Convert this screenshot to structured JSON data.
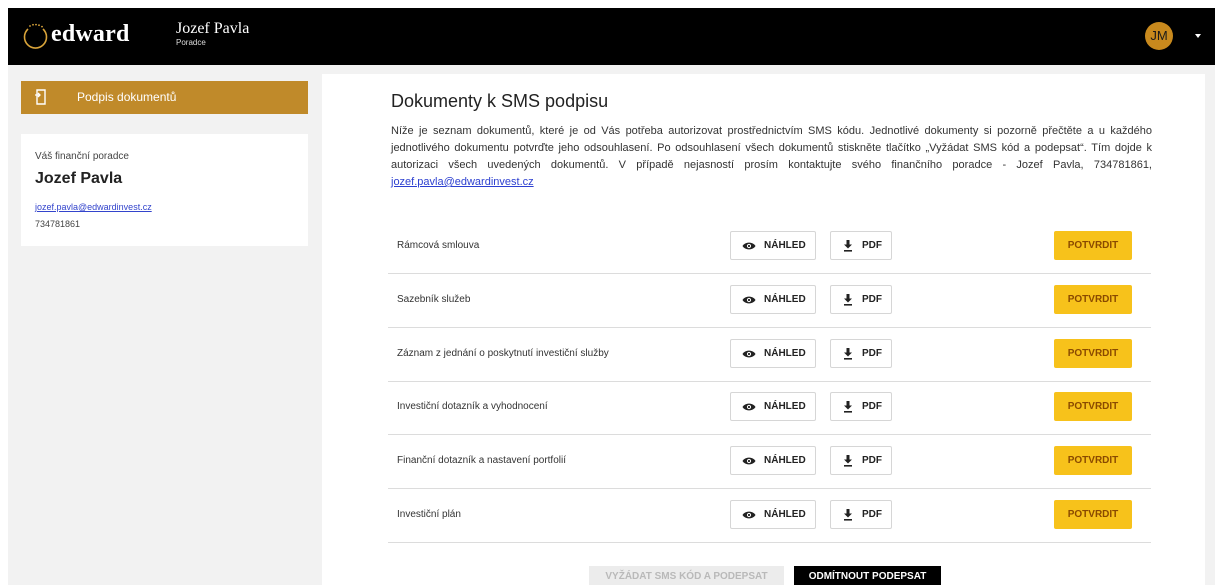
{
  "header": {
    "logo_text": "edward",
    "user_name": "Jozef Pavla",
    "user_role": "Poradce",
    "avatar_initials": "JM"
  },
  "sidebar": {
    "nav_item_label": "Podpis dokumentů",
    "advisor": {
      "label": "Váš finanční poradce",
      "name": "Jozef Pavla",
      "email": "jozef.pavla@edwardinvest.cz",
      "phone": "734781861"
    }
  },
  "main": {
    "title": "Dokumenty k SMS podpisu",
    "intro_text": "Níže je seznam dokumentů, které je od Vás potřeba autorizovat prostřednictvím SMS kódu. Jednotlivé dokumenty si pozorně přečtěte a u každého jednotlivého dokumentu potvrďte jeho odsouhlasení. Po odsouhlasení všech dokumentů stiskněte tlačítko „Vyžádat SMS kód a podepsat“. Tím dojde k autorizaci všech uvedených dokumentů. V případě nejasností prosím kontaktujte svého finančního poradce - Jozef Pavla, 734781861,",
    "intro_email": "jozef.pavla@edwardinvest.cz",
    "documents": [
      {
        "name": "Rámcová smlouva"
      },
      {
        "name": "Sazebník služeb"
      },
      {
        "name": "Záznam z jednání o poskytnutí investiční služby"
      },
      {
        "name": "Investiční dotazník a vyhodnocení"
      },
      {
        "name": "Finanční dotazník a nastavení portfolií"
      },
      {
        "name": "Investiční plán"
      }
    ],
    "preview_label": "NÁHLED",
    "pdf_label": "PDF",
    "confirm_label": "POTVRDIT",
    "request_sms_label": "VYŽÁDAT SMS KÓD A PODEPSAT",
    "decline_label": "ODMÍTNOUT PODEPSAT"
  },
  "colors": {
    "topbar": "#000000",
    "accent_gold": "#c08a2a",
    "confirm_yellow": "#f7c21b",
    "link_blue": "#2c3fd0"
  },
  "icons": {
    "logo": "sun-arc-icon",
    "nav": "document-sign-icon",
    "preview": "eye-icon",
    "pdf": "download-icon",
    "user_menu": "caret-down-icon"
  }
}
